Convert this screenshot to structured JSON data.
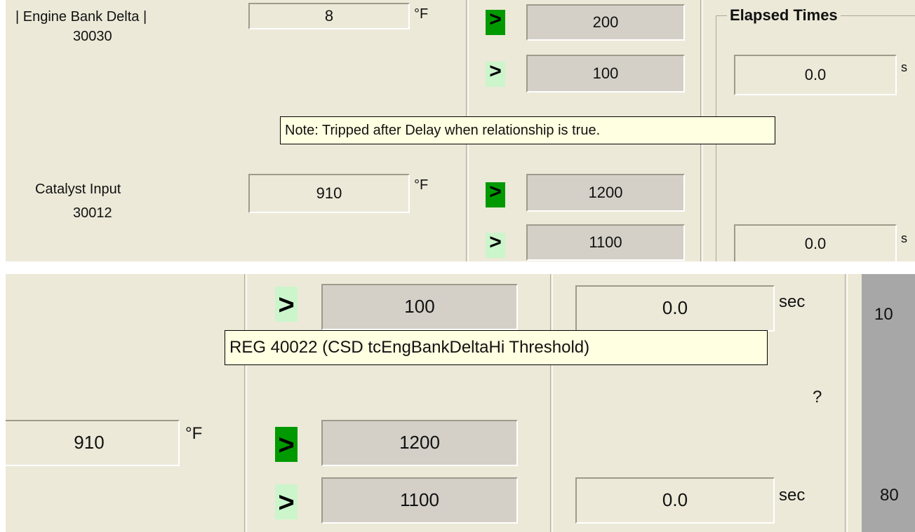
{
  "top": {
    "engine_label": "| Engine Bank Delta |",
    "engine_reg": "30030",
    "engine_value": "8",
    "engine_unit": "°F",
    "gt_symbol": ">",
    "engine_hi_threshold": "200",
    "engine_lo_threshold": "100",
    "elapsed_title": "Elapsed Times",
    "elapsed_1": "0.0",
    "elapsed_unit_partial": "s",
    "tooltip": "Note: Tripped after Delay when relationship is true.",
    "catalyst_label": "Catalyst Input",
    "catalyst_reg": "30012",
    "catalyst_value": "910",
    "catalyst_unit": "°F",
    "catalyst_hi_threshold": "1200",
    "catalyst_lo_threshold": "1100",
    "elapsed_2": "0.0"
  },
  "bottom": {
    "gt_symbol": ">",
    "engine_lo_threshold": "100",
    "elapsed_1": "0.0",
    "sec_label": "sec",
    "right_partial_1": "10",
    "tooltip": "REG 40022 (CSD tcEngBankDeltaHi Threshold)",
    "question": "?",
    "catalyst_value": "910",
    "catalyst_unit": "°F",
    "catalyst_hi_threshold": "1200",
    "catalyst_lo_threshold": "1100",
    "elapsed_2": "0.0",
    "right_partial_2": "80"
  },
  "colors": {
    "panel_bg": "#ece9d8",
    "threshold_bg": "#d4d0c8",
    "indicator_active": "#009a00",
    "indicator_inactive": "#ccf5cc",
    "tooltip_bg": "#ffffe1",
    "right_panel": "#a7a7a7"
  }
}
